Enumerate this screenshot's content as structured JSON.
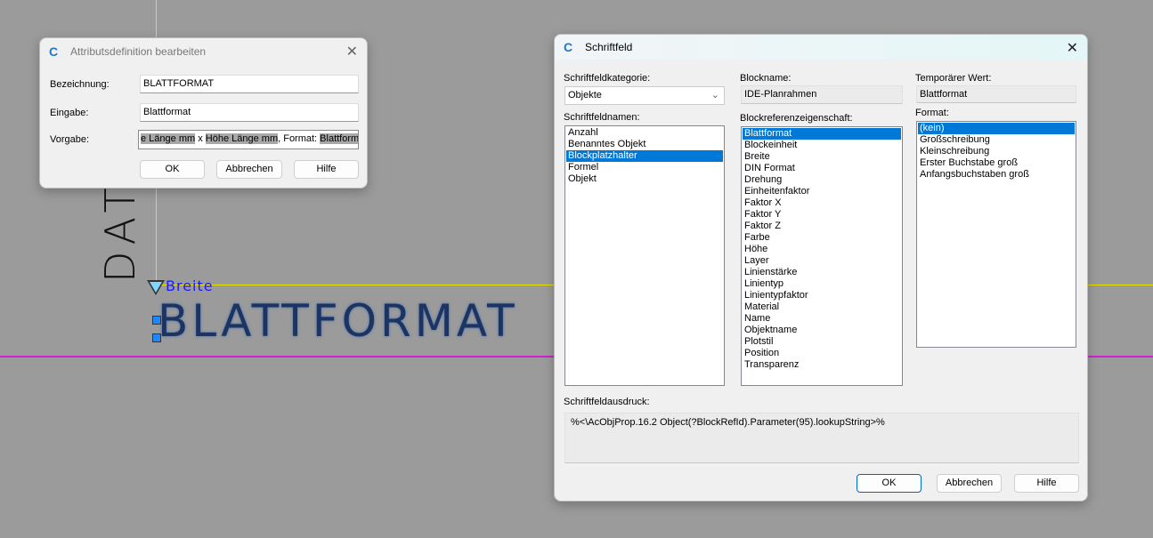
{
  "canvas": {
    "rotated_text": "DAT",
    "param_label": "Breite",
    "attribute_text": "BLATTFORMAT"
  },
  "attr_dialog": {
    "title": "Attributsdefinition bearbeiten",
    "labels": {
      "bezeichnung": "Bezeichnung:",
      "eingabe": "Eingabe:",
      "vorgabe": "Vorgabe:"
    },
    "values": {
      "bezeichnung": "BLATTFORMAT",
      "eingabe": "Blattformat",
      "vorgabe_parts": [
        "e Länge mm",
        " x ",
        "Höhe Länge mm",
        ", Format: ",
        "Blattformat"
      ]
    },
    "buttons": {
      "ok": "OK",
      "cancel": "Abbrechen",
      "help": "Hilfe"
    }
  },
  "field_dialog": {
    "title": "Schriftfeld",
    "category_label": "Schriftfeldkategorie:",
    "category_value": "Objekte",
    "names_label": "Schriftfeldnamen:",
    "names": [
      "Anzahl",
      "Benanntes Objekt",
      "Blockplatzhalter",
      "Formel",
      "Objekt"
    ],
    "names_selected": 2,
    "blockname_label": "Blockname:",
    "blockname_value": "IDE-Planrahmen",
    "props_label": "Blockreferenzeigenschaft:",
    "props": [
      "Blattformat",
      "Blockeinheit",
      "Breite",
      "DIN Format",
      "Drehung",
      "Einheitenfaktor",
      "Faktor X",
      "Faktor Y",
      "Faktor Z",
      "Farbe",
      "Höhe",
      "Layer",
      "Linienstärke",
      "Linientyp",
      "Linientypfaktor",
      "Material",
      "Name",
      "Objektname",
      "Plotstil",
      "Position",
      "Transparenz"
    ],
    "props_selected": 0,
    "temp_label": "Temporärer Wert:",
    "temp_value": "Blattformat",
    "format_label": "Format:",
    "formats": [
      "(kein)",
      "Großschreibung",
      "Kleinschreibung",
      "Erster Buchstabe groß",
      "Anfangsbuchstaben groß"
    ],
    "formats_selected": 0,
    "expr_label": "Schriftfeldausdruck:",
    "expr_value": "%<\\AcObjProp.16.2 Object(?BlockRefId).Parameter(95).lookupString>%",
    "buttons": {
      "ok": "OK",
      "cancel": "Abbrechen",
      "help": "Hilfe"
    }
  }
}
